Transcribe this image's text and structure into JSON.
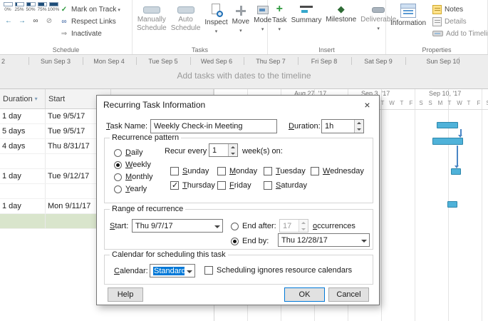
{
  "icons": {
    "close": "×",
    "mark_on_track": "✓",
    "respect_links": "∞",
    "inactivate": "⇒",
    "outdent": "←",
    "indent": "→",
    "link_tasks": "∞",
    "unlink_tasks": "⊘",
    "task_plus": "+",
    "milestone_diamond": "◆"
  },
  "colors": {
    "accent_blue": "#0078d7",
    "gantt_bar": "#4fb2d9",
    "selected_row_green": "#d9e5cc"
  },
  "ribbon": {
    "schedule": {
      "label": "Schedule",
      "percents": [
        "0%",
        "25%",
        "50%",
        "75%",
        "100%"
      ],
      "mark_on_track": "Mark on Track",
      "respect_links": "Respect Links",
      "inactivate": "Inactivate"
    },
    "tasks": {
      "label": "Tasks",
      "manually_schedule": "Manually\nSchedule",
      "auto_schedule": "Auto\nSchedule",
      "inspect": "Inspect",
      "move": "Move",
      "mode": "Mode"
    },
    "insert": {
      "label": "Insert",
      "task": "Task",
      "summary": "Summary",
      "milestone": "Milestone",
      "deliverable": "Deliverable"
    },
    "properties": {
      "label": "Properties",
      "information": "Information",
      "notes": "Notes",
      "details": "Details",
      "add_to_timeline": "Add to Timeline"
    }
  },
  "timeline": {
    "leading_fragment": "2",
    "dates": [
      "Sun Sep 3",
      "Mon Sep 4",
      "Tue Sep 5",
      "Wed Sep 6",
      "Thu Sep 7",
      "Fri Sep 8",
      "Sat Sep 9",
      "Sun Sep 10"
    ],
    "hint": "Add tasks with dates to the timeline"
  },
  "grid": {
    "columns": [
      "Duration",
      "Start"
    ],
    "rows": [
      {
        "duration": "1 day",
        "start": "Tue 9/5/17"
      },
      {
        "duration": "5 days",
        "start": "Tue 9/5/17"
      },
      {
        "duration": "4 days",
        "start": "Thu 8/31/17"
      },
      {
        "duration": "",
        "start": ""
      },
      {
        "duration": "1 day",
        "start": "Tue 9/12/17"
      },
      {
        "duration": "",
        "start": ""
      },
      {
        "duration": "1 day",
        "start": "Mon 9/11/17"
      },
      {
        "duration": "",
        "start": ""
      }
    ]
  },
  "gantt": {
    "week_labels": [
      "Aug 27, '17",
      "Sep 3, '17",
      "Sep 10, '17"
    ],
    "day_letters": [
      "T",
      "W",
      "T",
      "F",
      "S",
      "S",
      "M",
      "T",
      "W",
      "T",
      "F",
      "S"
    ]
  },
  "dialog": {
    "title": "Recurring Task Information",
    "task_name_label": "Task Name:",
    "task_name_value": "Weekly Check-in Meeting",
    "duration_label": "Duration:",
    "duration_value": "1h",
    "recurrence": {
      "group_label": "Recurrence pattern",
      "frequencies": [
        "Daily",
        "Weekly",
        "Monthly",
        "Yearly"
      ],
      "selected_frequency": "Weekly",
      "recur_every_label": "Recur every",
      "recur_every_value": "1",
      "recur_every_suffix": "week(s) on:",
      "days": [
        "Sunday",
        "Monday",
        "Tuesday",
        "Wednesday",
        "Thursday",
        "Friday",
        "Saturday"
      ],
      "checked_days": [
        "Thursday"
      ]
    },
    "range": {
      "group_label": "Range of recurrence",
      "start_label": "Start:",
      "start_value": "Thu 9/7/17",
      "end_after_label": "End after:",
      "end_after_value": "17",
      "occurrences_label": "occurrences",
      "end_by_label": "End by:",
      "end_by_value": "Thu 12/28/17",
      "selected_end": "End by"
    },
    "calendar": {
      "group_label": "Calendar for scheduling this task",
      "calendar_label": "Calendar:",
      "calendar_value": "Standard",
      "ignores_label": "Scheduling ignores resource calendars"
    },
    "buttons": {
      "help": "Help",
      "ok": "OK",
      "cancel": "Cancel"
    }
  }
}
